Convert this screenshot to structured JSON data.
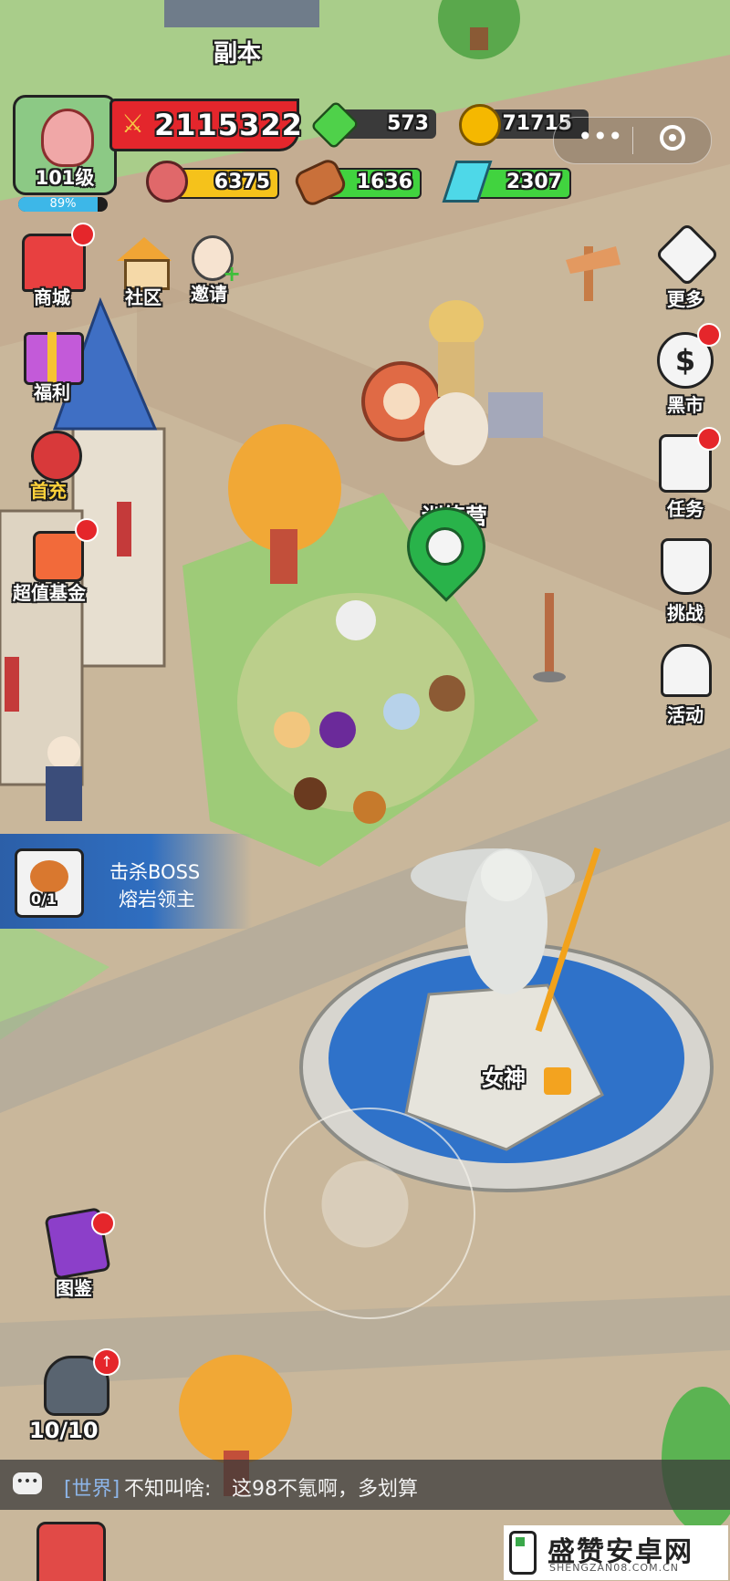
{
  "map": {
    "dungeon_label": "副本",
    "camp_label": "训练营",
    "statue_label": "女神"
  },
  "player": {
    "level_label": "101级",
    "exp_percent_text": "89%",
    "exp_percent": 0.89,
    "power": "2115322"
  },
  "resources": {
    "gems": "573",
    "gold": "71715",
    "meat": "6375",
    "wood": "1636",
    "crystal": "2307"
  },
  "left_menu": {
    "shop": "商城",
    "community": "社区",
    "invite": "邀请",
    "welfare": "福利",
    "first_charge": "首充",
    "fund": "超值基金",
    "codex": "图鉴",
    "heroes_count": "10/10"
  },
  "right_menu": {
    "more": "更多",
    "black_market": "黑市",
    "tasks": "任务",
    "challenge": "挑战",
    "events": "活动"
  },
  "quest": {
    "line1": "击杀BOSS",
    "line2": "熔岩领主",
    "progress": "0/1"
  },
  "chat": {
    "channel": "[世界]",
    "sender": "不知叫啥:",
    "message": "这98不氪啊，多划算"
  },
  "watermark": {
    "title": "盛赞安卓网",
    "url": "SHENGZAN08.COM.CN"
  },
  "colors": {
    "power_bar": "#e4262c",
    "gem_green": "#4fd14a",
    "gold": "#f5b800",
    "exp_bar": "#3db7e8",
    "meat_bar": "#f5c21b",
    "wood_bar": "#41d33f",
    "crystal_bar": "#41d33f"
  }
}
